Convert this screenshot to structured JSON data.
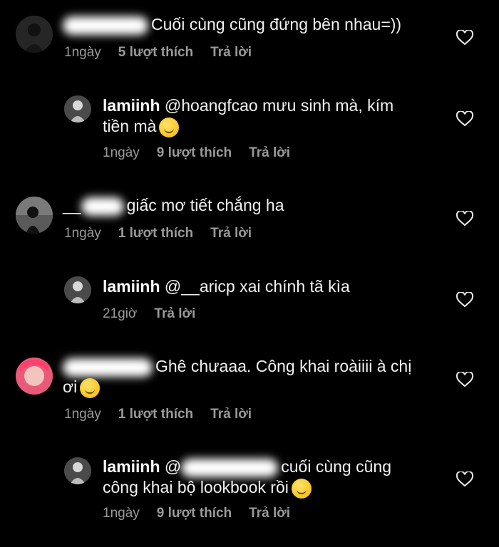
{
  "comments": [
    {
      "id": "c1",
      "type": "top",
      "username_blurred": true,
      "text_lines": [
        "Cuối cùng cũng đứng bên nhau=))"
      ],
      "time": "1ngày",
      "likes": "5 lượt thích",
      "reply": "Trả lời",
      "avatar_color": "#2a2a2a"
    },
    {
      "id": "r1",
      "type": "reply",
      "username": "lamiinh",
      "text_lines": [
        "@hoangfcao mưu sinh mà, kím",
        "tiền mà"
      ],
      "emoji": "crying-face-emoji",
      "time": "1ngày",
      "likes": "9 lượt thích",
      "reply": "Trả lời",
      "avatar_color": "#5a5a5a"
    },
    {
      "id": "c2",
      "type": "top",
      "username_blurred": true,
      "username_visible_prefix": "__",
      "text_lines": [
        "giấc mơ tiết chắng ha"
      ],
      "time": "1ngày",
      "likes": "1 lượt thích",
      "reply": "Trả lời",
      "avatar_color": "#6a6a6a"
    },
    {
      "id": "r2",
      "type": "reply",
      "username": "lamiinh",
      "text_lines": [
        "@__aricp xai chính tã kìa"
      ],
      "time": "21giờ",
      "reply": "Trả lời",
      "avatar_color": "#5a5a5a"
    },
    {
      "id": "c3",
      "type": "top",
      "username_blurred": true,
      "text_lines": [
        "Ghê chưaaa. Công khai roàiiii à chị",
        "ơi"
      ],
      "emoji": "smiling-face-with-hearts-emoji",
      "time": "1ngày",
      "likes": "1 lượt thích",
      "reply": "Trả lời",
      "avatar_color": "#e64b6b"
    },
    {
      "id": "r3",
      "type": "reply",
      "username": "lamiinh",
      "mention_prefix": "@",
      "mention_blurred": true,
      "text_lines": [
        "cuối cùng cũng",
        "công khai bộ lookbook rồi"
      ],
      "emoji": "zany-face-emoji",
      "time": "1ngày",
      "likes": "9 lượt thích",
      "reply": "Trả lời",
      "avatar_color": "#5a5a5a"
    }
  ],
  "icons": {
    "like": "heart-outline-icon"
  },
  "colors": {
    "background": "#000000",
    "text": "#f2f2f2",
    "meta": "#9a9a9a"
  }
}
